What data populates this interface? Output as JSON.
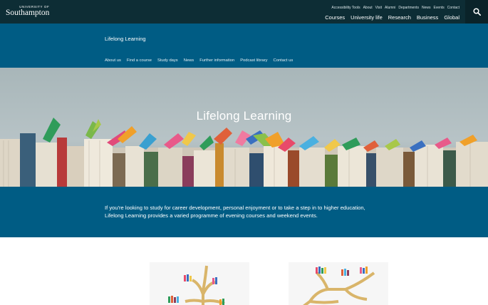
{
  "brand": {
    "logo_small": "UNIVERSITY OF",
    "logo_main": "Southampton"
  },
  "utility_nav": [
    "Accessibility Tools",
    "About",
    "Visit",
    "Alumni",
    "Departments",
    "News",
    "Events",
    "Contact"
  ],
  "main_nav": [
    "Courses",
    "University life",
    "Research",
    "Business",
    "Global"
  ],
  "search": {
    "icon": "search-icon"
  },
  "section": {
    "title": "Lifelong Learning",
    "nav": [
      "About us",
      "Find a course",
      "Study days",
      "News",
      "Further information",
      "Podcast library",
      "Contact us"
    ]
  },
  "hero": {
    "title": "Lifelong Learning"
  },
  "intro": {
    "text": "If you're looking to study for career development, personal enjoyment or to take a step in to higher education, Lifelong Learning provides a varied programme of evening courses and weekend events."
  },
  "colors": {
    "header_dark": "#0d2d35",
    "brand_blue": "#005c84"
  }
}
